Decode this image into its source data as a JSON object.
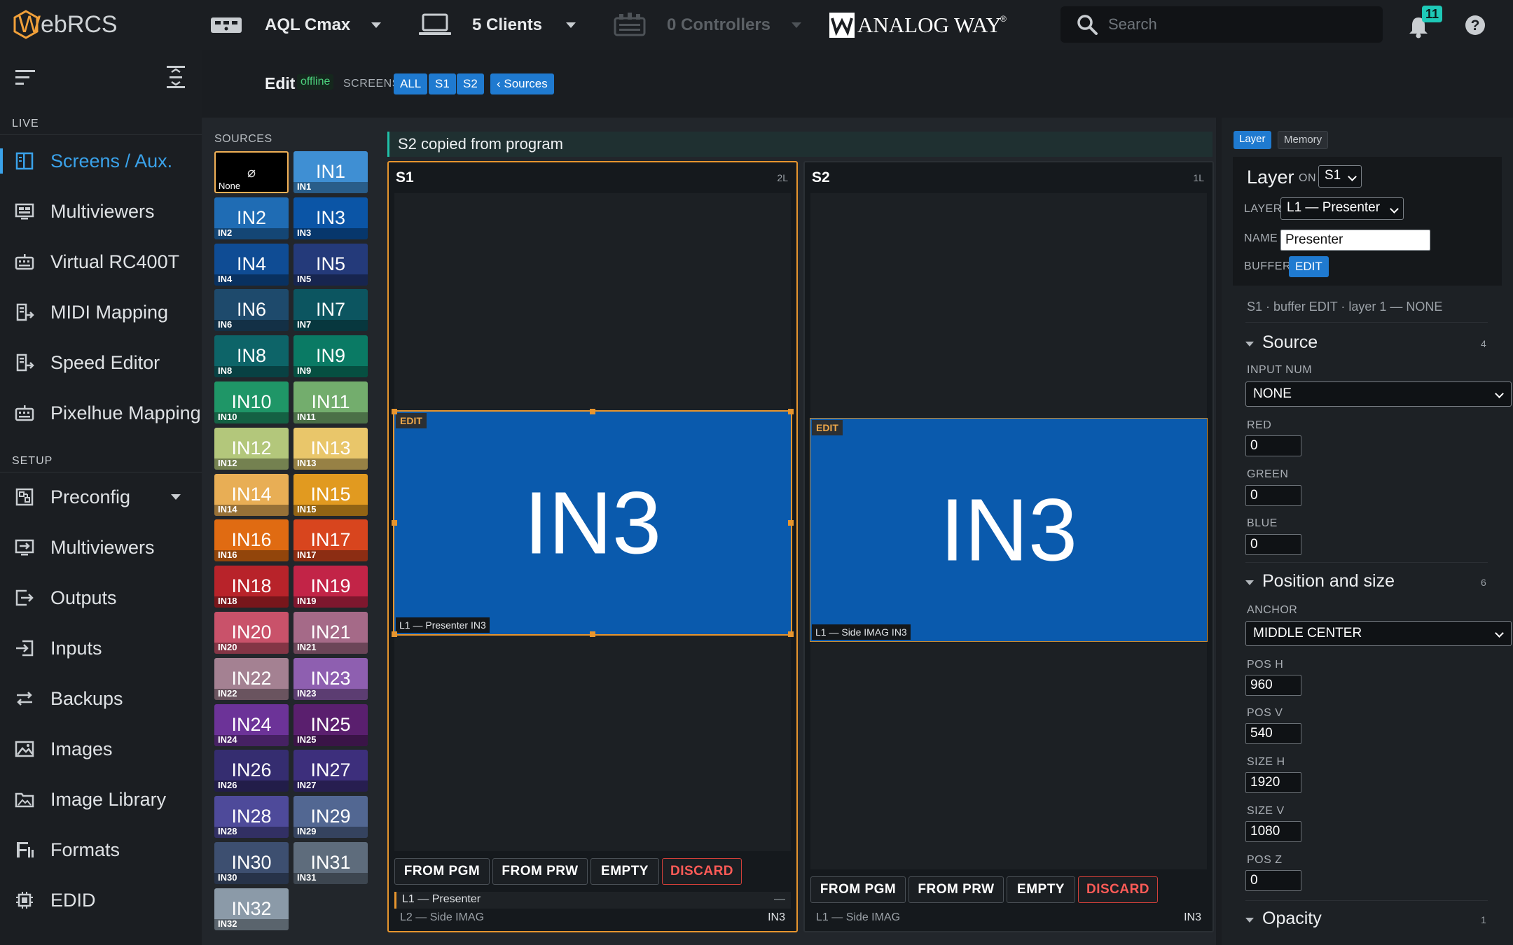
{
  "app": {
    "logo_w": "W",
    "logo_rest": "ebRCS",
    "device_name": "AQL Cmax",
    "clients_label": "5 Clients",
    "controllers_label": "0 Controllers",
    "brand": "ANALOG WAY",
    "brand_mark": "®",
    "search_placeholder": "Search",
    "notification_count": "11"
  },
  "sidebar": {
    "section_live": "LIVE",
    "section_setup": "SETUP",
    "live_items": [
      {
        "label": "Screens / Aux.",
        "icon": "screens-icon"
      },
      {
        "label": "Multiviewers",
        "icon": "multiviewer-icon"
      },
      {
        "label": "Virtual RC400T",
        "icon": "keyboard-icon"
      },
      {
        "label": "MIDI Mapping",
        "icon": "midi-icon"
      },
      {
        "label": "Speed Editor",
        "icon": "speed-editor-icon"
      },
      {
        "label": "Pixelhue Mapping",
        "icon": "pixelhue-icon"
      }
    ],
    "setup_items": [
      {
        "label": "Preconfig",
        "icon": "preconfig-icon"
      },
      {
        "label": "Multiviewers",
        "icon": "multiviewer-icon"
      },
      {
        "label": "Outputs",
        "icon": "outputs-icon"
      },
      {
        "label": "Inputs",
        "icon": "inputs-icon"
      },
      {
        "label": "Backups",
        "icon": "backups-icon"
      },
      {
        "label": "Images",
        "icon": "images-icon"
      },
      {
        "label": "Image Library",
        "icon": "image-library-icon"
      },
      {
        "label": "Formats",
        "icon": "formats-icon"
      },
      {
        "label": "EDID",
        "icon": "edid-icon"
      }
    ]
  },
  "edit_header": {
    "title": "Edit",
    "status": "offline",
    "screens_label": "SCREENS",
    "btn_all": "ALL",
    "btn_s1": "S1",
    "btn_s2": "S2",
    "btn_sources": "‹ Sources"
  },
  "sources": {
    "heading": "SOURCES",
    "none_glyph": "⌀",
    "none_label": "None",
    "tiles": [
      {
        "label": "IN1",
        "color": "#3f8fd3"
      },
      {
        "label": "IN2",
        "color": "#1f6cb4"
      },
      {
        "label": "IN3",
        "color": "#0b55a6"
      },
      {
        "label": "IN4",
        "color": "#0f4c94"
      },
      {
        "label": "IN5",
        "color": "#243a7a"
      },
      {
        "label": "IN6",
        "color": "#1e4a6c"
      },
      {
        "label": "IN7",
        "color": "#0c5560"
      },
      {
        "label": "IN8",
        "color": "#0d6468"
      },
      {
        "label": "IN9",
        "color": "#0a7a64"
      },
      {
        "label": "IN10",
        "color": "#1f9667"
      },
      {
        "label": "IN11",
        "color": "#73ad6d"
      },
      {
        "label": "IN12",
        "color": "#b3c77b"
      },
      {
        "label": "IN13",
        "color": "#e9c66a"
      },
      {
        "label": "IN14",
        "color": "#e8ae55"
      },
      {
        "label": "IN15",
        "color": "#e19a20"
      },
      {
        "label": "IN16",
        "color": "#e06b12"
      },
      {
        "label": "IN17",
        "color": "#d8451e"
      },
      {
        "label": "IN18",
        "color": "#b8232a"
      },
      {
        "label": "IN19",
        "color": "#c22447"
      },
      {
        "label": "IN20",
        "color": "#c9526a"
      },
      {
        "label": "IN21",
        "color": "#a56a88"
      },
      {
        "label": "IN22",
        "color": "#a48192"
      },
      {
        "label": "IN23",
        "color": "#8e5fb0"
      },
      {
        "label": "IN24",
        "color": "#6c3398"
      },
      {
        "label": "IN25",
        "color": "#5a1f6e"
      },
      {
        "label": "IN26",
        "color": "#352d70"
      },
      {
        "label": "IN27",
        "color": "#3d2f7c"
      },
      {
        "label": "IN28",
        "color": "#4e4a9a"
      },
      {
        "label": "IN29",
        "color": "#526792"
      },
      {
        "label": "IN30",
        "color": "#3d4f70"
      },
      {
        "label": "IN31",
        "color": "#5e6c7c"
      },
      {
        "label": "IN32",
        "color": "#8b9aa8"
      }
    ]
  },
  "notice": "S2 copied from program",
  "screens": [
    {
      "name": "S1",
      "layers_count": "2L",
      "edit_tag": "EDIT",
      "layer_text": "IN3",
      "layer_caption": "L1 — Presenter IN3",
      "buttons": [
        "FROM PGM",
        "FROM PRW",
        "EMPTY",
        "DISCARD"
      ],
      "layer_list": [
        {
          "name": "L1 — Presenter",
          "value": "—"
        },
        {
          "name": "L2 — Side IMAG",
          "value": "IN3"
        }
      ]
    },
    {
      "name": "S2",
      "layers_count": "1L",
      "edit_tag": "EDIT",
      "layer_text": "IN3",
      "layer_caption": "L1 — Side IMAG IN3",
      "buttons": [
        "FROM PGM",
        "FROM PRW",
        "EMPTY",
        "DISCARD"
      ],
      "layer_list": [
        {
          "name": "L1 — Side IMAG",
          "value": "IN3"
        }
      ]
    }
  ],
  "right_panel": {
    "tab_layer": "Layer",
    "tab_memory": "Memory",
    "card_title": "Layer",
    "on_label": "ON",
    "screen_value": "S1",
    "layer_label": "LAYER",
    "layer_value": "L1 — Presenter",
    "name_label": "NAME",
    "name_value": "Presenter",
    "buffer_label": "BUFFER",
    "buffer_value": "EDIT",
    "status_line": "S1 · buffer EDIT · layer 1 — NONE",
    "source_section": {
      "title": "Source",
      "count": "4",
      "input_num_label": "INPUT NUM",
      "input_num_value": "NONE",
      "red_label": "RED",
      "red_value": "0",
      "green_label": "GREEN",
      "green_value": "0",
      "blue_label": "BLUE",
      "blue_value": "0"
    },
    "position_section": {
      "title": "Position and size",
      "count": "6",
      "anchor_label": "ANCHOR",
      "anchor_value": "MIDDLE CENTER",
      "pos_h_label": "POS H",
      "pos_h_value": "960",
      "pos_v_label": "POS V",
      "pos_v_value": "540",
      "size_h_label": "SIZE H",
      "size_h_value": "1920",
      "size_v_label": "SIZE V",
      "size_v_value": "1080",
      "pos_z_label": "POS Z",
      "pos_z_value": "0"
    },
    "opacity_section": {
      "title": "Opacity",
      "count": "1"
    }
  }
}
